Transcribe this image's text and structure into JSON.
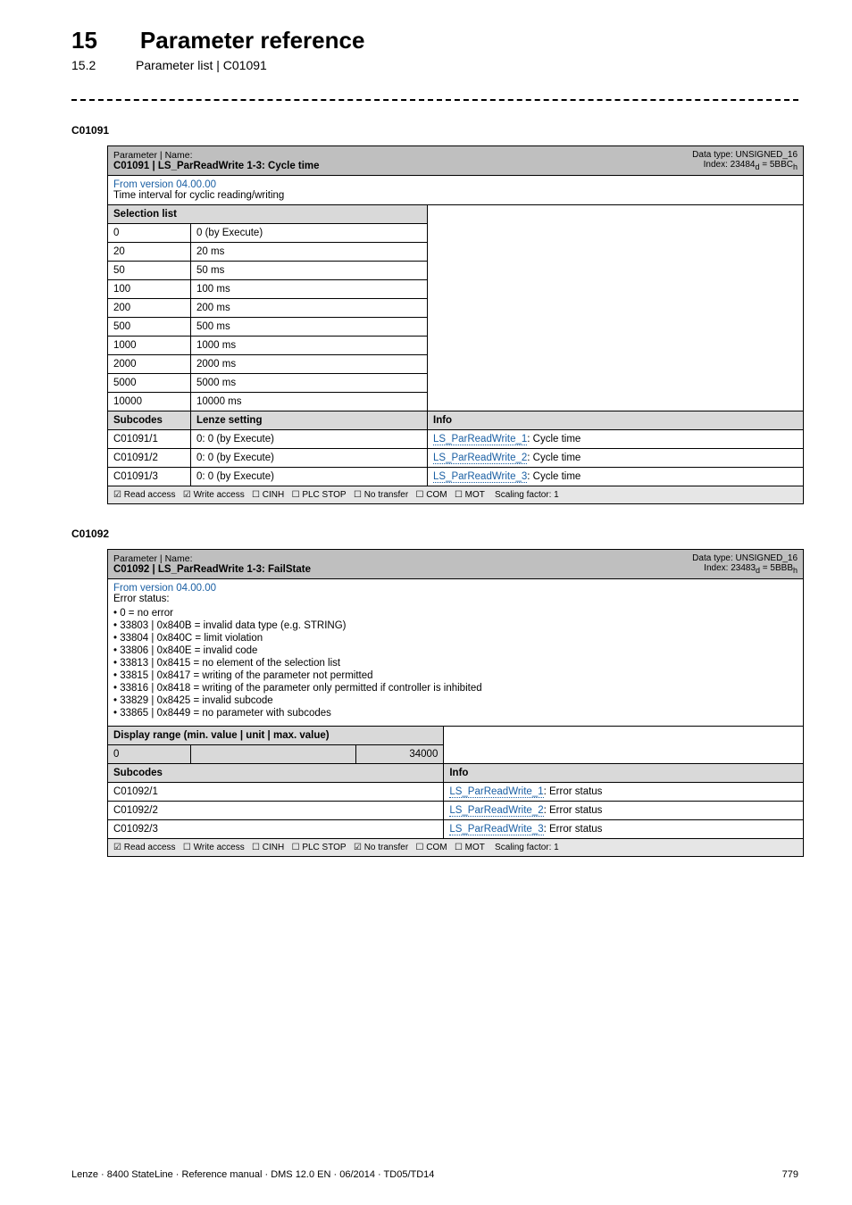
{
  "header": {
    "chapter_num": "15",
    "chapter_title": "Parameter reference",
    "section_num": "15.2",
    "section_title": "Parameter list | C01091"
  },
  "anchor1": "C01091",
  "table1": {
    "param_label": "Parameter | Name:",
    "param_code": "C01091 | LS_ParReadWrite 1-3: Cycle time",
    "datatype_line1": "Data type: UNSIGNED_16",
    "datatype_line2_a": "Index: 23484",
    "datatype_line2_b": " = 5BBC",
    "version": "From version 04.00.00",
    "desc": "Time interval for cyclic reading/writing",
    "sel_list": "Selection list",
    "rows": [
      {
        "n": "0",
        "v": "0 (by Execute)"
      },
      {
        "n": "20",
        "v": "20 ms"
      },
      {
        "n": "50",
        "v": "50 ms"
      },
      {
        "n": "100",
        "v": "100 ms"
      },
      {
        "n": "200",
        "v": "200 ms"
      },
      {
        "n": "500",
        "v": "500 ms"
      },
      {
        "n": "1000",
        "v": "1000 ms"
      },
      {
        "n": "2000",
        "v": "2000 ms"
      },
      {
        "n": "5000",
        "v": "5000 ms"
      },
      {
        "n": "10000",
        "v": "10000 ms"
      }
    ],
    "subcodes_h": "Subcodes",
    "lenze_h": "Lenze setting",
    "info_h": "Info",
    "subrows": [
      {
        "c": "C01091/1",
        "s": "0: 0 (by Execute)",
        "link": "LS_ParReadWrite_1",
        "tail": ": Cycle time"
      },
      {
        "c": "C01091/2",
        "s": "0: 0 (by Execute)",
        "link": "LS_ParReadWrite_2",
        "tail": ": Cycle time"
      },
      {
        "c": "C01091/3",
        "s": "0: 0 (by Execute)",
        "link": "LS_ParReadWrite_3",
        "tail": ": Cycle time"
      }
    ],
    "access": {
      "read": "☑ Read access",
      "write": "☑ Write access",
      "cinh": "☐ CINH",
      "plc": "☐ PLC STOP",
      "notransfer": "☐ No transfer",
      "com": "☐ COM",
      "mot": "☐ MOT",
      "scale": "Scaling factor: 1"
    }
  },
  "anchor2": "C01092",
  "table2": {
    "param_label": "Parameter | Name:",
    "param_code": "C01092 | LS_ParReadWrite 1-3: FailState",
    "datatype_line1": "Data type: UNSIGNED_16",
    "datatype_line2_a": "Index: 23483",
    "datatype_line2_b": " = 5BBB",
    "version": "From version 04.00.00",
    "errstatus": "Error status:",
    "bullets": [
      "• 0 = no error",
      "• 33803 | 0x840B = invalid data type (e.g. STRING)",
      "• 33804 | 0x840C = limit violation",
      "• 33806 | 0x840E = invalid code",
      "• 33813 | 0x8415 = no element of the selection list",
      "• 33815 | 0x8417 = writing of the parameter not permitted",
      "• 33816 | 0x8418 = writing of the parameter only permitted if controller is inhibited",
      "• 33829 | 0x8425 = invalid subcode",
      "• 33865 | 0x8449 = no parameter with subcodes"
    ],
    "display_range": "Display range (min. value | unit | max. value)",
    "dr_min": "0",
    "dr_max": "34000",
    "subcodes_h": "Subcodes",
    "info_h": "Info",
    "subrows": [
      {
        "c": "C01092/1",
        "link": "LS_ParReadWrite_1",
        "tail": ": Error status"
      },
      {
        "c": "C01092/2",
        "link": "LS_ParReadWrite_2",
        "tail": ": Error status"
      },
      {
        "c": "C01092/3",
        "link": "LS_ParReadWrite_3",
        "tail": ": Error status"
      }
    ],
    "access": {
      "read": "☑ Read access",
      "write": "☐ Write access",
      "cinh": "☐ CINH",
      "plc": "☐ PLC STOP",
      "notransfer": "☑ No transfer",
      "com": "☐ COM",
      "mot": "☐ MOT",
      "scale": "Scaling factor: 1"
    }
  },
  "footer": {
    "left": "Lenze · 8400 StateLine · Reference manual · DMS 12.0 EN · 06/2014 · TD05/TD14",
    "right": "779"
  }
}
